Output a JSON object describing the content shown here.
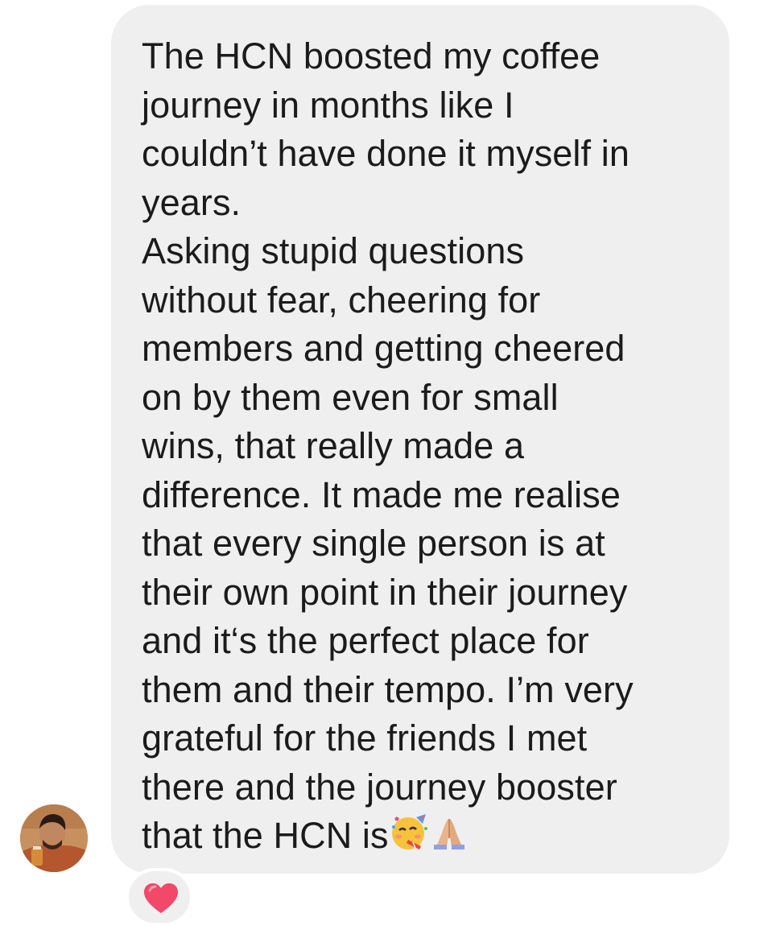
{
  "message": {
    "lines": [
      "The HCN boosted my coffee",
      "journey in months like I",
      "couldn’t have done it myself in",
      "years.",
      "Asking stupid questions",
      "without fear, cheering for",
      "members and getting cheered",
      "on by them even for small",
      "wins, that really made a",
      "difference. It made me realise",
      "that every single person is at",
      "their own point in their journey",
      "and it‘s the perfect place for",
      "them and their tempo. I’m very",
      "grateful for the friends I met",
      "there and the journey booster",
      "that the HCN is"
    ],
    "trailing_emoji": [
      "partying-face-emoji",
      "folded-hands-emoji"
    ]
  },
  "sender": {
    "avatar": "profile-photo"
  },
  "reaction": {
    "emoji": "red-heart-emoji"
  },
  "colors": {
    "bubble": "#efefef",
    "text": "#1b1b1b",
    "heart": "#f2486a"
  }
}
